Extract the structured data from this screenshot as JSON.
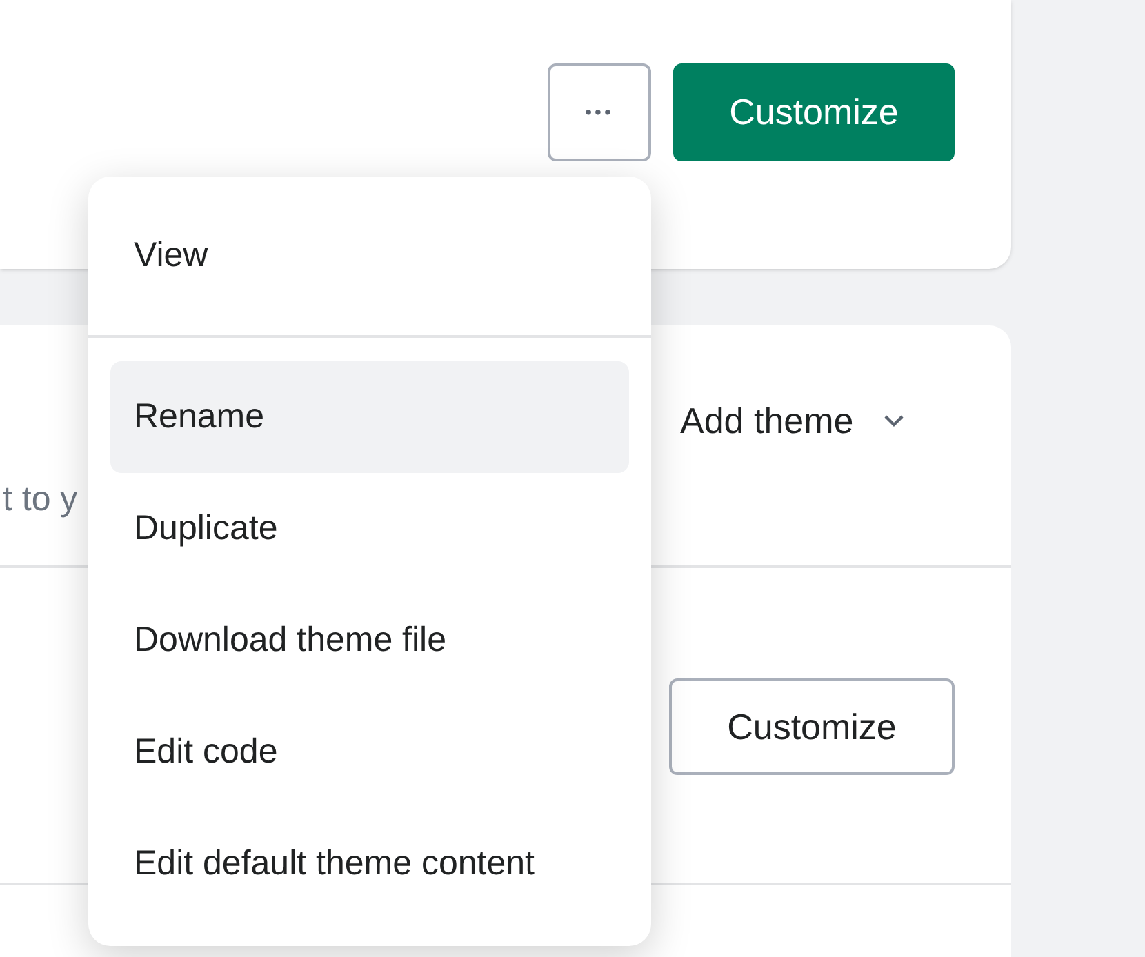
{
  "current_theme": {
    "more_button": "•••",
    "customize_button": "Customize"
  },
  "theme_library": {
    "add_theme": "Add theme",
    "description_fragment": "t to y",
    "rows": [
      {
        "customize_button": "Customize"
      }
    ]
  },
  "menu": {
    "sections": [
      [
        {
          "label": "View",
          "selected": false
        }
      ],
      [
        {
          "label": "Rename",
          "selected": true
        },
        {
          "label": "Duplicate",
          "selected": false
        },
        {
          "label": "Download theme file",
          "selected": false
        },
        {
          "label": "Edit code",
          "selected": false
        },
        {
          "label": "Edit default theme content",
          "selected": false
        }
      ]
    ]
  }
}
